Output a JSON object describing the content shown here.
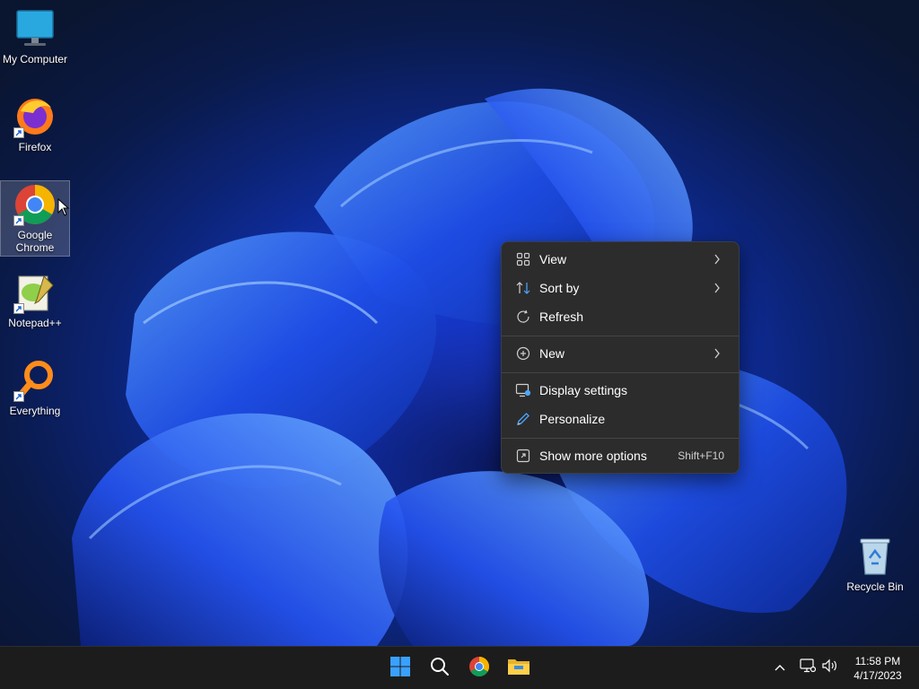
{
  "desktop": {
    "icons": [
      {
        "label": "My Computer"
      },
      {
        "label": "Firefox"
      },
      {
        "label": "Google Chrome"
      },
      {
        "label": "Notepad++"
      },
      {
        "label": "Everything"
      },
      {
        "label": "Recycle Bin"
      }
    ]
  },
  "context_menu": {
    "items": [
      {
        "label": "View",
        "icon": "grid-view-icon",
        "submenu": true
      },
      {
        "label": "Sort by",
        "icon": "sort-arrows-icon",
        "submenu": true
      },
      {
        "label": "Refresh",
        "icon": "refresh-icon"
      },
      {
        "label": "New",
        "icon": "plus-circle-icon",
        "submenu": true
      },
      {
        "label": "Display settings",
        "icon": "display-settings-icon"
      },
      {
        "label": "Personalize",
        "icon": "pen-icon"
      },
      {
        "label": "Show more options",
        "icon": "expand-icon",
        "shortcut": "Shift+F10"
      }
    ]
  },
  "taskbar": {
    "apps": [
      "windows-start-icon",
      "search-icon",
      "chrome-icon",
      "file-explorer-icon"
    ],
    "tray": [
      "chevron-up-icon",
      "network-icon",
      "volume-icon"
    ],
    "clock": {
      "time": "11:58 PM",
      "date": "4/17/2023"
    }
  },
  "colors": {
    "accent": "#1a3ddb",
    "menu_bg": "#2c2c2c",
    "taskbar_bg": "#1c1c1c"
  }
}
